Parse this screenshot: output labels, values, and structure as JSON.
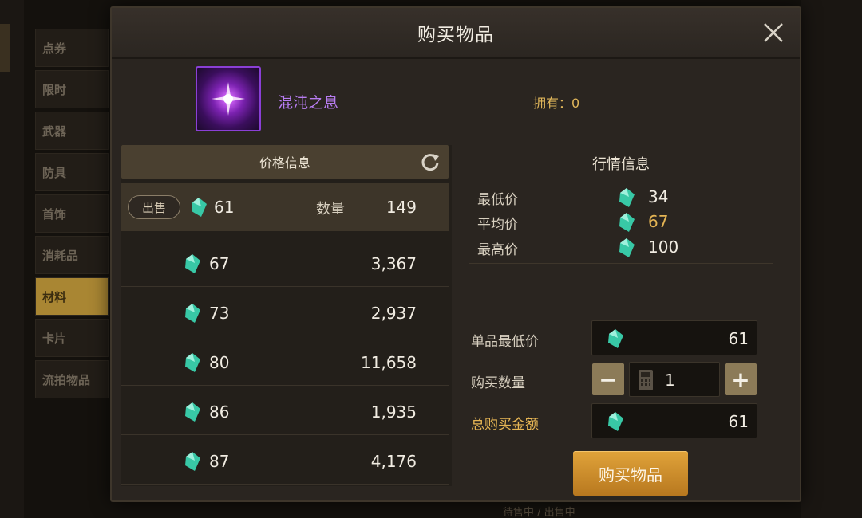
{
  "background": {
    "tabs": [
      "点券",
      "限时",
      "武器",
      "防具",
      "首饰",
      "消耗品",
      "材料",
      "卡片",
      "流拍物品"
    ],
    "active_tab": 6,
    "bottom_tag": "待售中 / 出售中"
  },
  "dialog": {
    "title": "购买物品",
    "close_icon": "close-icon",
    "item": {
      "name": "混沌之息",
      "icon": "chaos-breath-orb-icon",
      "owned": "拥有：0"
    }
  },
  "price_list": {
    "header": "价格信息",
    "refresh_icon": "refresh-icon",
    "sell_label": "出售",
    "qty_label": "数量",
    "currency_icon": "gem-icon",
    "rows": [
      {
        "price": "61",
        "qty": "149"
      },
      {
        "price": "67",
        "qty": "3,367"
      },
      {
        "price": "73",
        "qty": "2,937"
      },
      {
        "price": "80",
        "qty": "11,658"
      },
      {
        "price": "86",
        "qty": "1,935"
      },
      {
        "price": "87",
        "qty": "4,176"
      }
    ]
  },
  "market": {
    "header": "行情信息",
    "lowest_label": "最低价",
    "lowest_value": "34",
    "average_label": "平均价",
    "average_value": "67",
    "highest_label": "最高价",
    "highest_value": "100"
  },
  "purchase": {
    "unit_price_label": "单品最低价",
    "unit_price_value": "61",
    "quantity_label": "购买数量",
    "quantity_value": "1",
    "minus_label": "−",
    "plus_label": "+",
    "total_label": "总购买金额",
    "total_value": "61",
    "buy_button": "购买物品"
  },
  "colors": {
    "accent_gold": "#e5b554",
    "item_purple": "#b77cf0",
    "gem_teal": "#38c8a6"
  }
}
